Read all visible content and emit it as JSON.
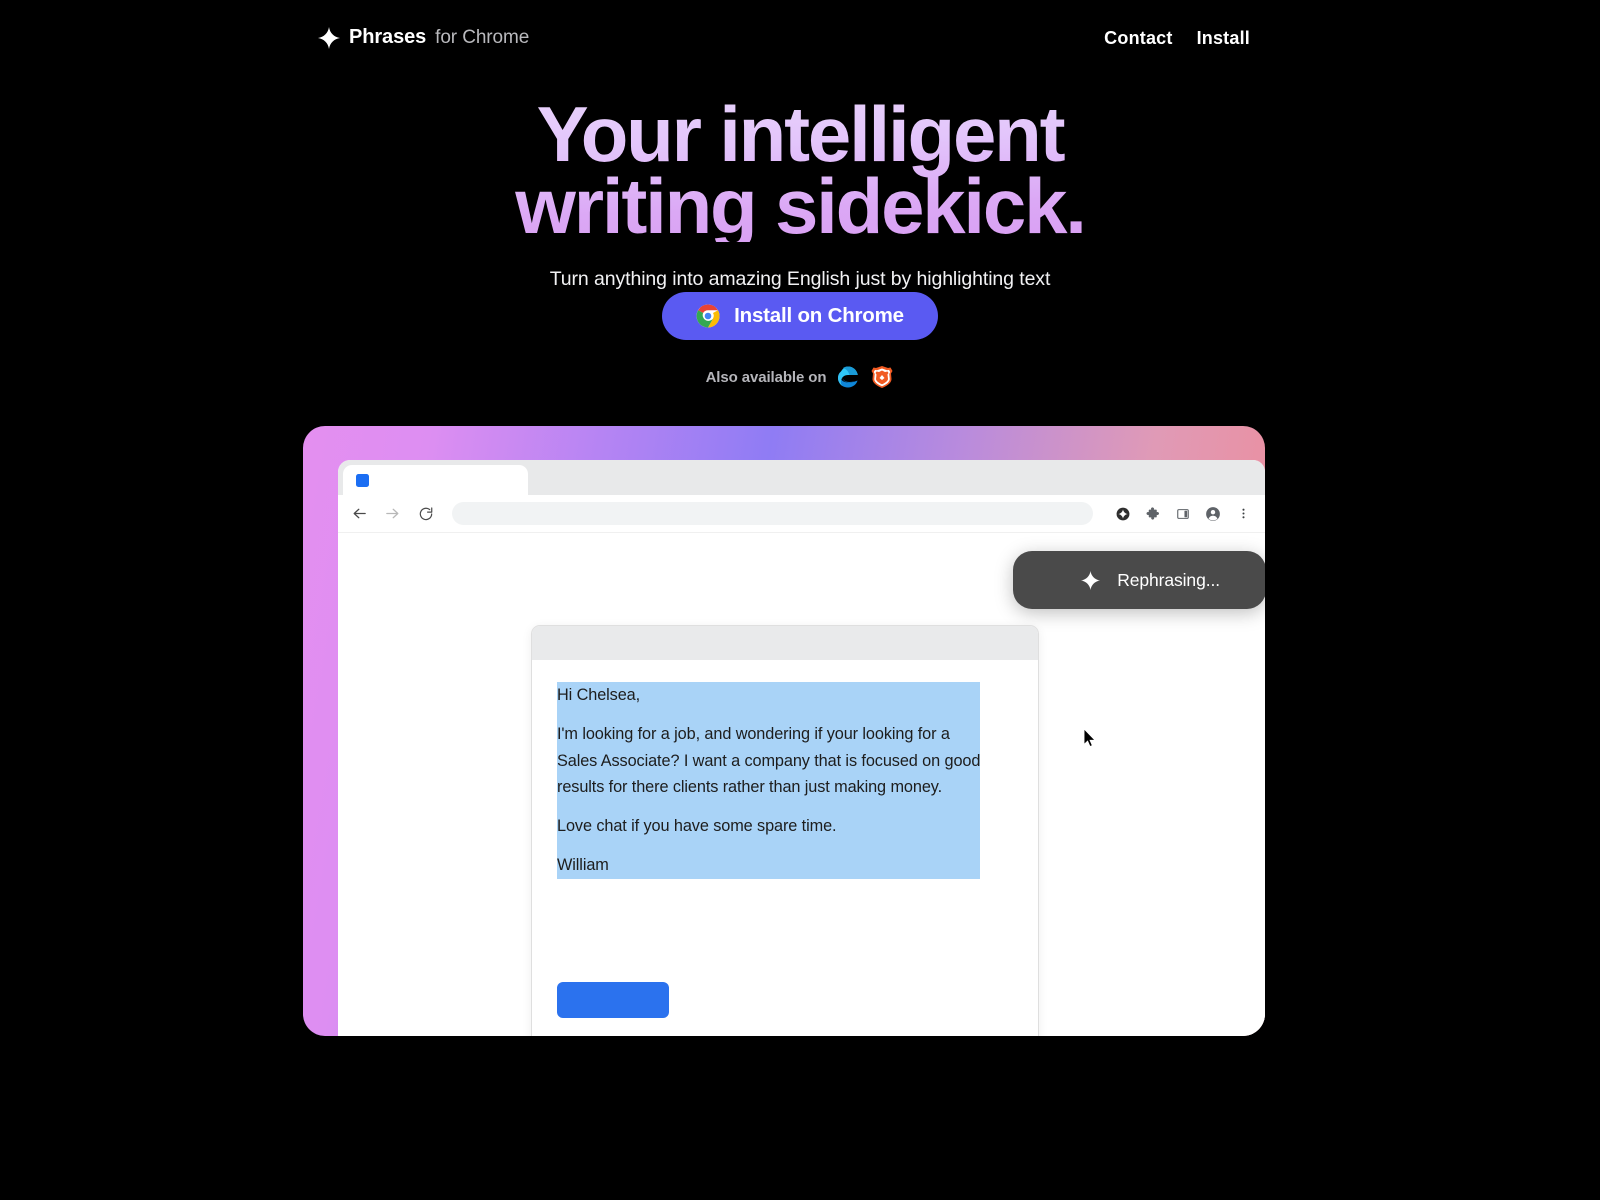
{
  "header": {
    "brand_name": "Phrases",
    "brand_subtitle": "for Chrome",
    "brand_icon": "sparkle-icon",
    "nav": [
      {
        "label": "Contact"
      },
      {
        "label": "Install"
      }
    ]
  },
  "hero": {
    "title_line1": "Your intelligent",
    "title_line2": "writing sidekick.",
    "subtitle": "Turn anything into amazing English just by highlighting text",
    "title_gradient_from": "#ead7fb",
    "title_gradient_to": "#d99cf2"
  },
  "cta": {
    "button_label": "Install on Chrome",
    "button_icon": "chrome-logo-icon",
    "button_color": "#5a5af2",
    "also_label": "Also available on",
    "also_browsers": [
      {
        "name": "edge-logo-icon"
      },
      {
        "name": "brave-logo-icon"
      }
    ]
  },
  "showcase": {
    "frame_gradient_start": "#e48ff0",
    "frame_gradient_mid": "#8f7cf4",
    "frame_gradient_end": "#f08a95",
    "browser": {
      "tab": {
        "favicon_color": "#1b6ef3",
        "title": ""
      },
      "omnibox_value": "",
      "omnibox_placeholder": "",
      "nav_icons": [
        {
          "name": "back-arrow-icon"
        },
        {
          "name": "forward-arrow-icon"
        },
        {
          "name": "reload-icon"
        }
      ],
      "toolbar_icons": [
        {
          "name": "phrases-extension-icon"
        },
        {
          "name": "puzzle-piece-icon"
        },
        {
          "name": "side-panel-icon"
        },
        {
          "name": "profile-avatar-icon"
        },
        {
          "name": "three-dot-menu-icon"
        }
      ]
    },
    "tooltip": {
      "text": "Rephrasing...",
      "icon": "sparkle-icon",
      "background": "#4a4a4a"
    },
    "compose": {
      "selection_color": "#a9d3f7",
      "send_button_color": "#2b72ee",
      "send_button_label": "",
      "mail": {
        "greeting": "Hi Chelsea,",
        "paragraph1_line1": "I'm looking for a job, and wondering if your looking for a",
        "paragraph1_line2": "Sales Associate? I want a company that is focused on good",
        "paragraph1_line3": "results for there clients rather than just making money.",
        "paragraph2": "Love chat if you have some spare time.",
        "signature": "William"
      }
    }
  }
}
